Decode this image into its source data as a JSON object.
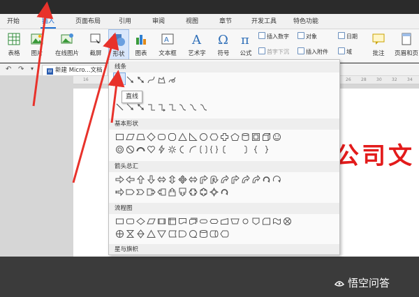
{
  "menubar": {
    "tabs": [
      "开始",
      "插入",
      "页面布局",
      "引用",
      "审阅",
      "视图",
      "章节",
      "开发工具",
      "特色功能"
    ],
    "active": "插入"
  },
  "ribbon": {
    "table": "表格",
    "picture": "图片",
    "online_picture": "在线图片",
    "screenshot": "截屏",
    "shapes": "形状",
    "chart": "图表",
    "textbox": "文本框",
    "wordart": "艺术字",
    "symbol": "符号",
    "formula": "公式",
    "insert_number": "插入数字",
    "object": "对象",
    "date": "日期",
    "drop_cap": "首字下沉",
    "attachment": "插入附件",
    "field": "域",
    "comment": "批注",
    "header_footer": "页眉和页"
  },
  "docbar": {
    "tab_label": "新建 Micro...文档"
  },
  "ruler": {
    "left_mark": "16",
    "marks": [
      "26",
      "28",
      "30",
      "32",
      "34"
    ]
  },
  "document": {
    "big_text": "公司文"
  },
  "shapes_panel": {
    "sections": {
      "lines": "线条",
      "basic": "基本形状",
      "arrows": "箭头总汇",
      "flowchart": "流程图",
      "stars": "星与旗帜"
    },
    "tooltip": "直线"
  },
  "watermark": {
    "text": "悟空问答"
  },
  "colors": {
    "accent": "#1d6fd1",
    "red": "#e31b1b",
    "panel": "#fafafa"
  }
}
